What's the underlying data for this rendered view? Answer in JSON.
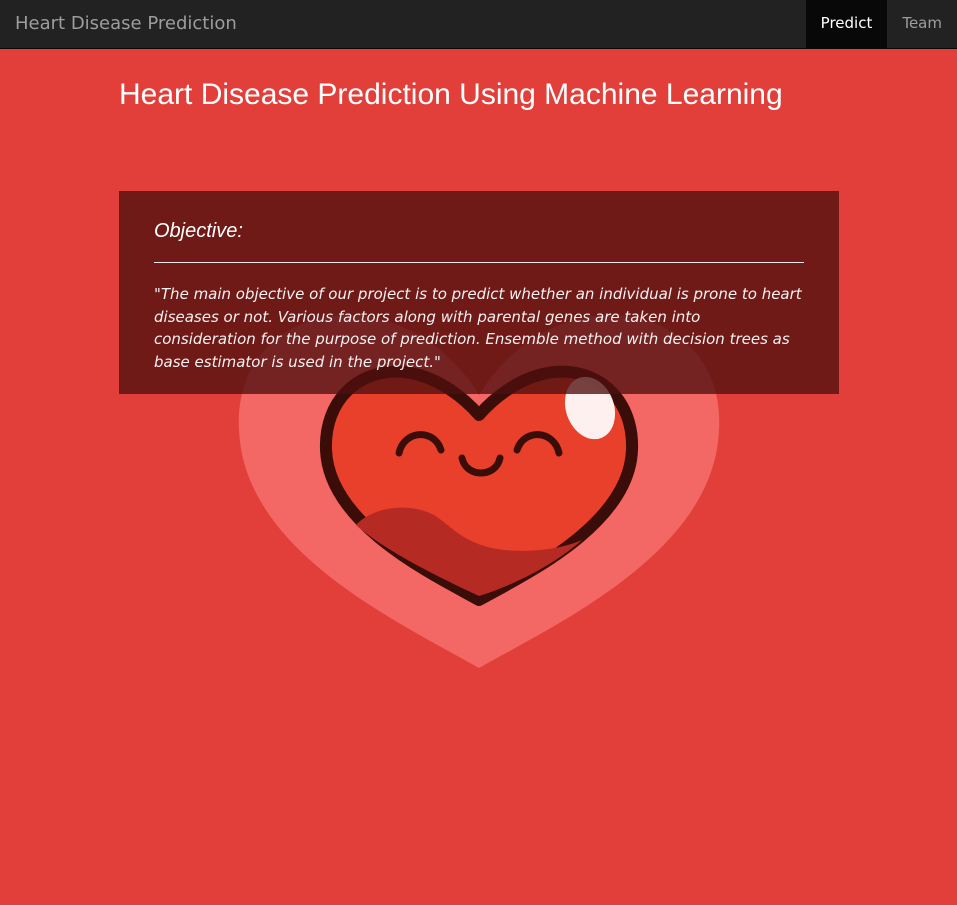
{
  "navbar": {
    "brand": "Heart Disease Prediction",
    "links": [
      {
        "label": "Predict",
        "active": true
      },
      {
        "label": "Team",
        "active": false
      }
    ]
  },
  "main": {
    "title": "Heart Disease Prediction Using Machine Learning",
    "objective": {
      "heading": "Objective:",
      "text": "\"The main objective of our project is to predict whether an individual is prone to heart diseases or not. Various factors along with parental genes are taken into consideration for the purpose of prediction. Ensemble method with decision trees as base estimator is used in the project.\""
    }
  },
  "background": {
    "image": "smiling-heart-icon",
    "color": "#e23f3a"
  }
}
